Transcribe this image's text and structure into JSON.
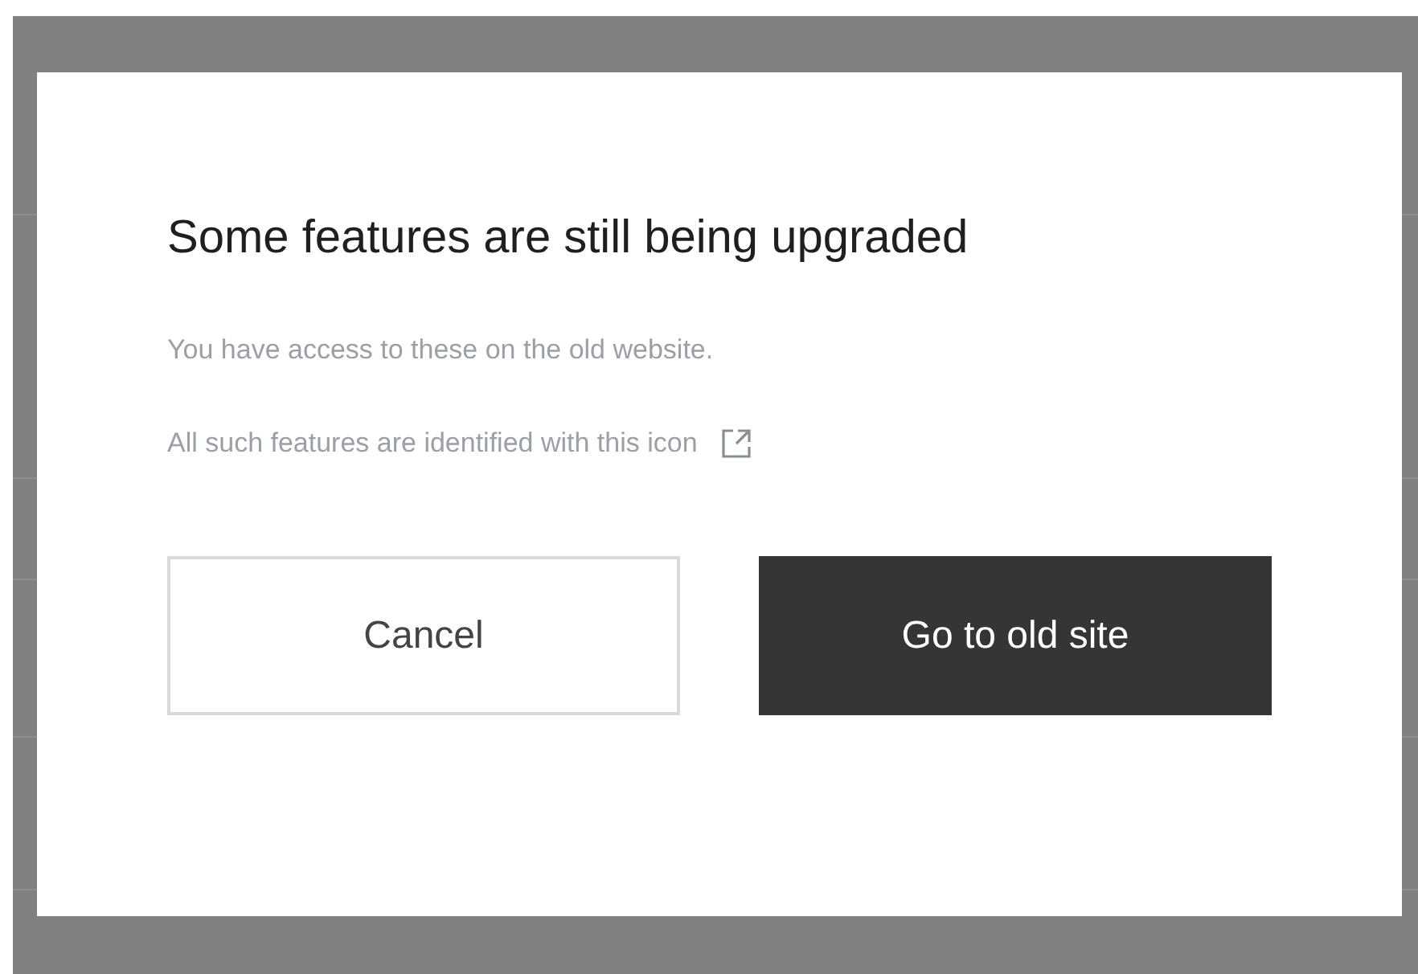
{
  "dialog": {
    "title": "Some features are still being upgraded",
    "lines": [
      "You have access to these on the old website.",
      "All such features are identified with this icon"
    ],
    "buttons": [
      {
        "label": "Cancel",
        "kind": "secondary"
      },
      {
        "label": "Go to old site",
        "kind": "primary"
      }
    ]
  }
}
